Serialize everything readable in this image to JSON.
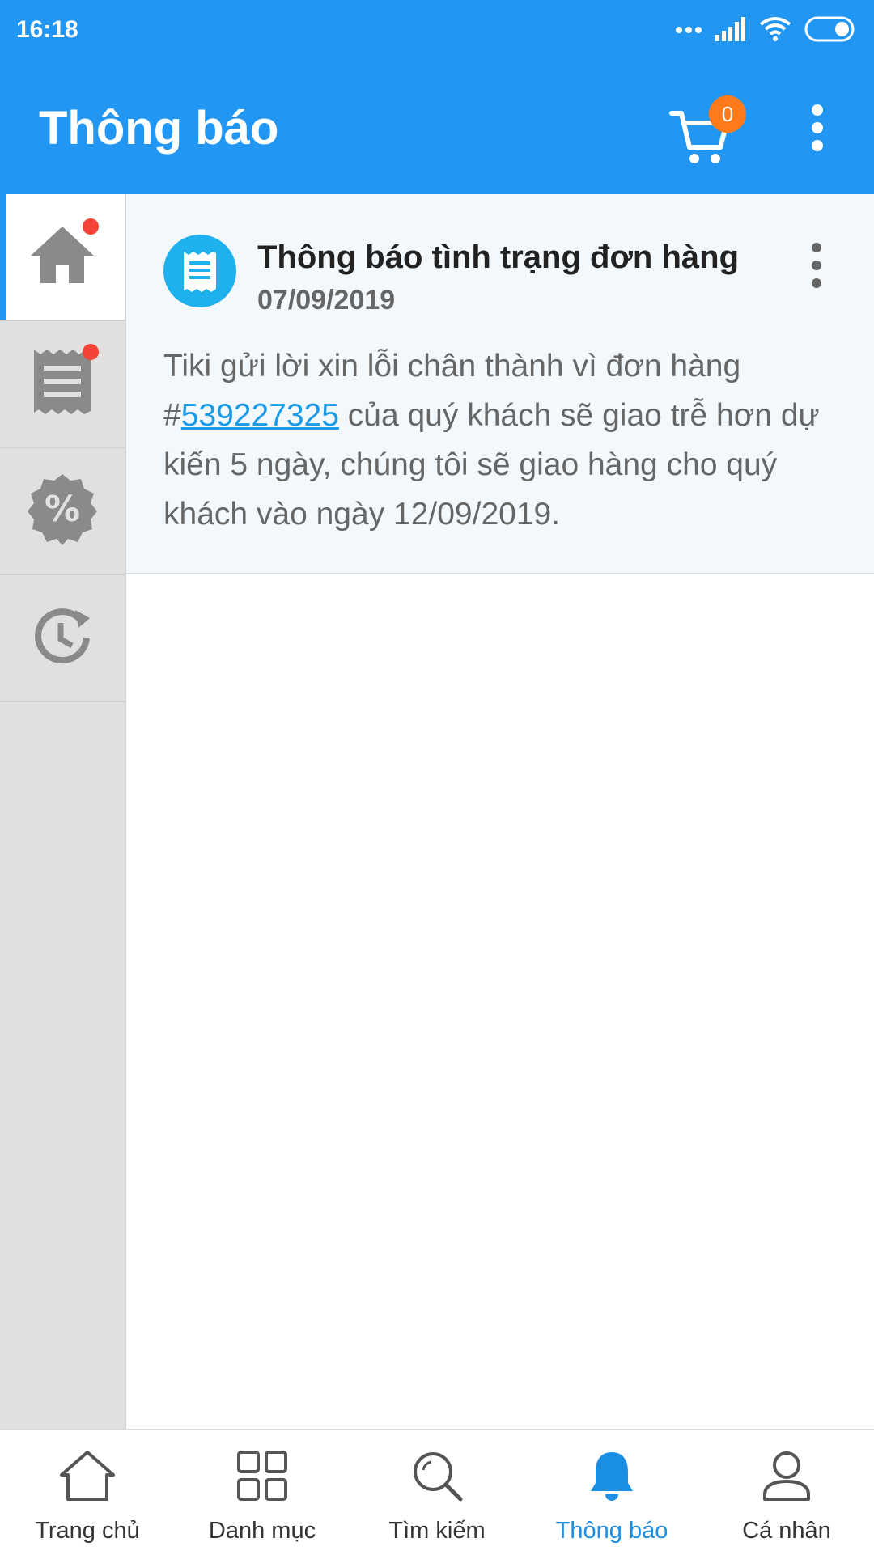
{
  "status_bar": {
    "time": "16:18"
  },
  "header": {
    "title": "Thông báo",
    "cart_count": "0"
  },
  "sidebar": {
    "items": [
      {
        "icon": "home-icon",
        "active": true,
        "dot": true
      },
      {
        "icon": "receipt-icon",
        "active": false,
        "dot": true
      },
      {
        "icon": "discount-icon",
        "active": false,
        "dot": false
      },
      {
        "icon": "history-icon",
        "active": false,
        "dot": false
      }
    ]
  },
  "notification": {
    "title": "Thông báo tình trạng đơn hàng",
    "date": "07/09/2019",
    "body_prefix": "Tiki gửi lời xin lỗi chân thành vì đơn hàng #",
    "order_link": "539227325",
    "body_suffix": " của quý khách sẽ giao trễ hơn dự kiến 5 ngày, chúng tôi sẽ giao hàng cho quý khách vào ngày 12/09/2019."
  },
  "bottom_nav": {
    "items": [
      {
        "label": "Trang chủ",
        "icon": "home-outline-icon"
      },
      {
        "label": "Danh mục",
        "icon": "grid-icon"
      },
      {
        "label": "Tìm kiếm",
        "icon": "search-icon"
      },
      {
        "label": "Thông báo",
        "icon": "bell-icon",
        "active": true
      },
      {
        "label": "Cá nhân",
        "icon": "person-icon"
      }
    ]
  },
  "colors": {
    "primary": "#2196f3",
    "badge": "#ff7a1a",
    "dot": "#f44336",
    "link": "#1a9be8"
  }
}
